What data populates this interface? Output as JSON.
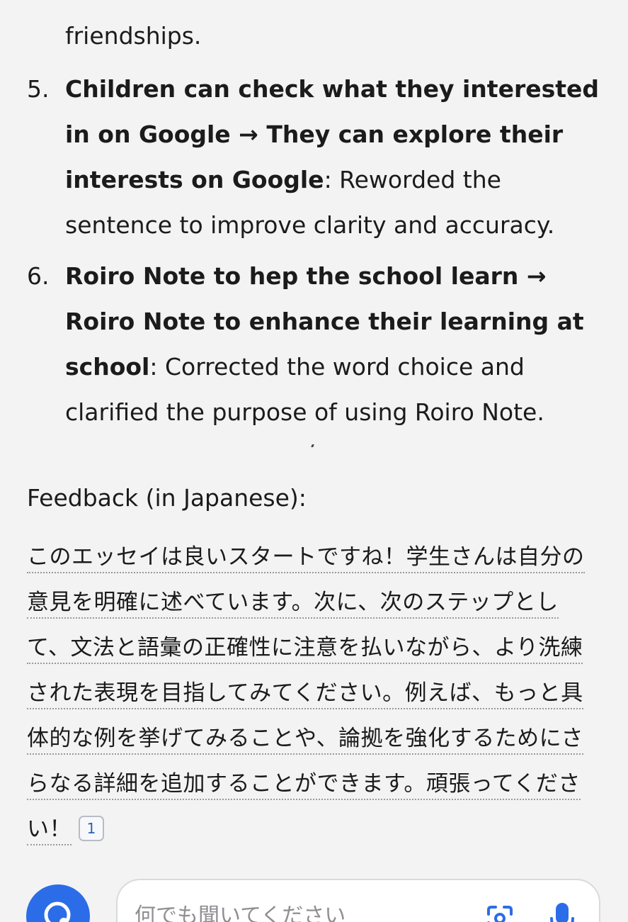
{
  "intro_continuation": "friendships.",
  "corrections": [
    {
      "number": "5.",
      "bold": "Children can check what they interested in on Google → They can explore their interests on Google",
      "rest": ": Reworded the sentence to improve clarity and accuracy."
    },
    {
      "number": "6.",
      "bold": "Roiro Note to hep the school learn → Roiro Note to enhance their learning at school",
      "rest": ": Corrected the word choice and clarified the purpose of using Roiro Note."
    }
  ],
  "feedback": {
    "heading": "Feedback (in Japanese):",
    "text": "このエッセイは良いスタートですね！学生さんは自分の意見を明確に述べています。次に、次のステップとして、文法と語彙の正確性に注意を払いながら、より洗練された表現を目指してみてください。例えば、もっと具体的な例を挙げてみることや、論拠を強化するためにさらなる詳細を追加することができます。頑張ってください！",
    "citation": "1"
  },
  "composer": {
    "placeholder": "何でも聞いてください"
  },
  "colors": {
    "background": "#f3f3f4",
    "accent": "#2b6de8",
    "citation_text": "#2b5fb8"
  },
  "icons": {
    "fab": "assistant-spark-icon",
    "lens": "google-lens-icon",
    "mic": "microphone-icon"
  }
}
